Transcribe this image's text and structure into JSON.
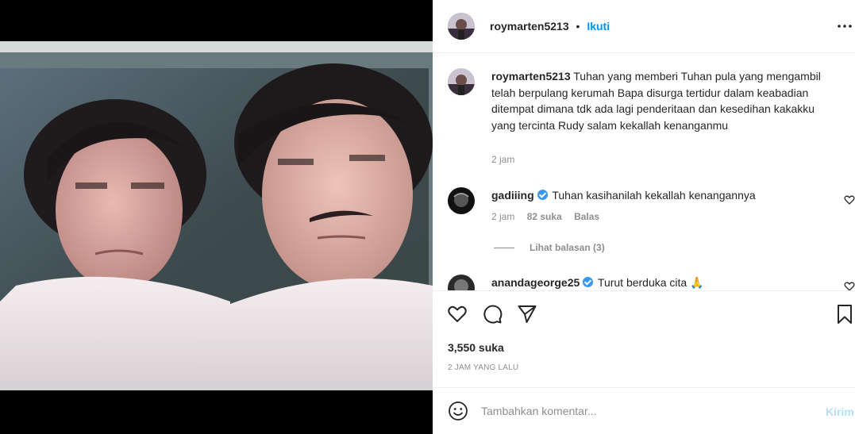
{
  "post": {
    "username": "roymarten5213",
    "follow_label": "Ikuti",
    "dot": "•"
  },
  "caption": {
    "username": "roymarten5213",
    "text": "Tuhan yang memberi Tuhan pula yang mengambil telah berpulang kerumah Bapa disurga tertidur dalam keabadian ditempat dimana tdk ada lagi penderitaan dan kesedihan kakakku yang tercinta Rudy salam kekallah kenanganmu",
    "time": "2 jam"
  },
  "comments": [
    {
      "username": "gadiiing",
      "text": "Tuhan kasihanilah kekallah kenangannya",
      "time": "2 jam",
      "likes": "82 suka",
      "reply_label": "Balas",
      "view_replies": "Lihat balasan (3)"
    },
    {
      "username": "anandageorge25",
      "text": "Turut berduka cita 🙏"
    }
  ],
  "likes_count": "3,550 suka",
  "timestamp": "2 JAM YANG LALU",
  "composer": {
    "placeholder": "Tambahkan komentar...",
    "submit_label": "Kirim"
  },
  "colors": {
    "accent": "#0095f6",
    "accent_disabled": "#b2dffc",
    "muted": "#8e8e8e",
    "border": "#efefef",
    "verified": "#3897f0"
  },
  "icons": [
    "more-options-icon",
    "like-icon",
    "comment-icon",
    "share-icon",
    "save-icon",
    "emoji-icon",
    "heart-small-icon",
    "verified-badge-icon"
  ]
}
